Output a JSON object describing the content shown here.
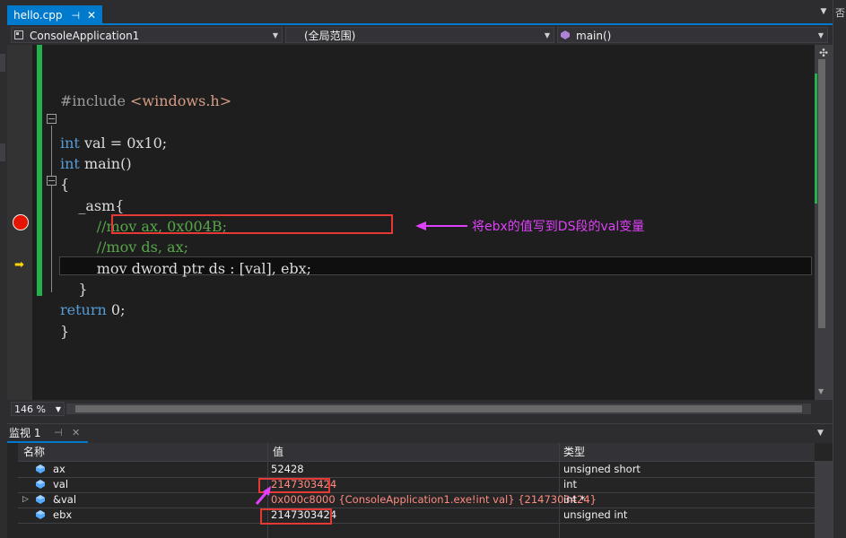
{
  "tab": {
    "title": "hello.cpp",
    "pin": "⊣",
    "close": "✕"
  },
  "nav": {
    "project": "ConsoleApplication1",
    "scope": "(全局范围)",
    "member": "main()"
  },
  "code_lines": [
    {
      "kind": "include",
      "pre": "#include ",
      "arg": "<windows.h>"
    },
    {
      "kind": "blank"
    },
    {
      "kind": "decl",
      "kw": "int",
      "rest": " val = 0x10;"
    },
    {
      "kind": "decl",
      "kw": "int",
      "rest": " main()"
    },
    {
      "kind": "plain",
      "text": "{"
    },
    {
      "kind": "plain",
      "text": "    _asm{"
    },
    {
      "kind": "comment",
      "text": "        //mov ax, 0x004B;"
    },
    {
      "kind": "comment",
      "text": "        //mov ds, ax;"
    },
    {
      "kind": "plain",
      "text": "        mov dword ptr ds : [val], ebx;"
    },
    {
      "kind": "plain",
      "text": "    }"
    },
    {
      "kind": "ret",
      "kw": "return",
      "rest": " 0;"
    },
    {
      "kind": "plain",
      "text": "}"
    }
  ],
  "annotation": "将ebx的值写到DS段的val变量",
  "zoom": "146 %",
  "right_edge_label": "否",
  "watch": {
    "title": "监视 1",
    "pin": "⊣",
    "close": "✕",
    "columns": {
      "name": "名称",
      "value": "值",
      "type": "类型"
    },
    "rows": [
      {
        "expand": "",
        "icon": "field-icon",
        "name": "ax",
        "value": "52428",
        "type": "unsigned short",
        "value_color": "normal"
      },
      {
        "expand": "",
        "icon": "variable-icon",
        "name": "val",
        "value": "2147303424",
        "type": "int",
        "value_color": "changed"
      },
      {
        "expand": "▷",
        "icon": "field-icon",
        "name": "&val",
        "value": "0x000c8000 {ConsoleApplication1.exe!int val} {2147303424}",
        "type": "int *",
        "value_color": "changed"
      },
      {
        "expand": "",
        "icon": "field-icon",
        "name": "ebx",
        "value": "2147303424",
        "type": "unsigned int",
        "value_color": "normal"
      }
    ]
  },
  "colors": {
    "accent": "#007acc",
    "breakpoint": "#e51400",
    "highlight": "#e53935",
    "annotation": "#e040fb",
    "changed": "#ff8a80"
  }
}
